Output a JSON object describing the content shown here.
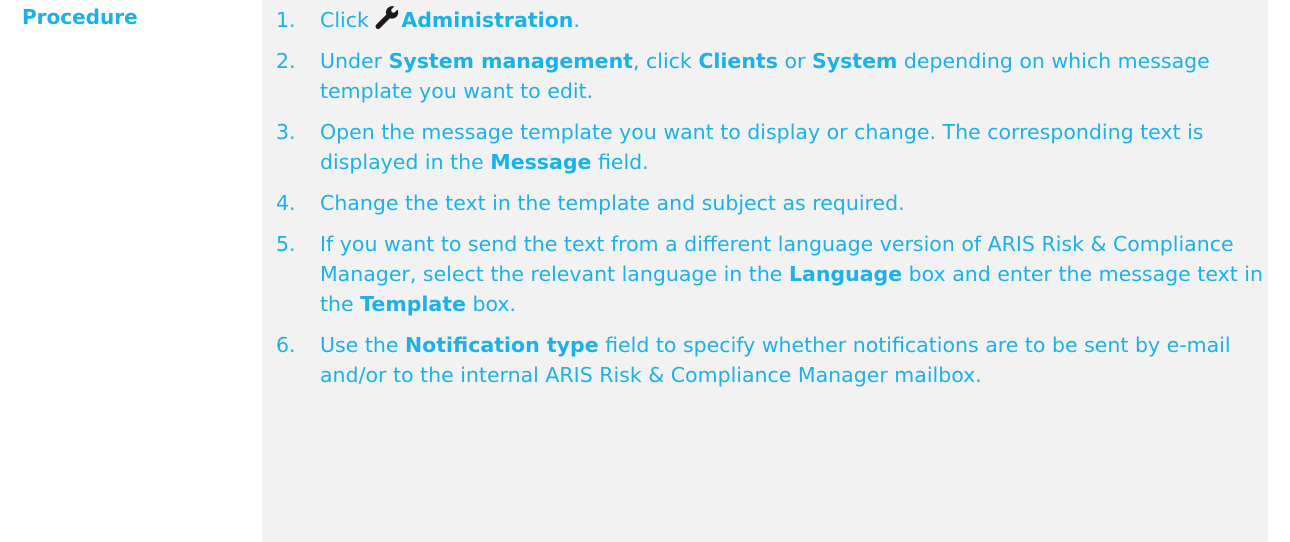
{
  "procedure": {
    "label": "Procedure",
    "steps": [
      {
        "number": "1.",
        "parts": [
          {
            "text": "Click ",
            "bold": false
          },
          {
            "icon": "wrench-icon"
          },
          {
            "text": "Administration",
            "bold": true
          },
          {
            "text": ".",
            "bold": false
          }
        ]
      },
      {
        "number": "2.",
        "parts": [
          {
            "text": "Under ",
            "bold": false
          },
          {
            "text": "System management",
            "bold": true
          },
          {
            "text": ", click ",
            "bold": false
          },
          {
            "text": "Clients",
            "bold": true
          },
          {
            "text": " or ",
            "bold": false
          },
          {
            "text": "System",
            "bold": true
          },
          {
            "text": " depending on which message template you want to edit.",
            "bold": false
          }
        ]
      },
      {
        "number": "3.",
        "parts": [
          {
            "text": "Open the message template you want to display or change. The corresponding text is displayed in the ",
            "bold": false
          },
          {
            "text": "Message",
            "bold": true
          },
          {
            "text": " field.",
            "bold": false
          }
        ]
      },
      {
        "number": "4.",
        "parts": [
          {
            "text": "Change the text in the template and subject as required.",
            "bold": false
          }
        ]
      },
      {
        "number": "5.",
        "parts": [
          {
            "text": "If you want to send the text from a different language version of ARIS Risk & Compliance Manager, select the relevant language in the ",
            "bold": false
          },
          {
            "text": "Language",
            "bold": true
          },
          {
            "text": " box and enter the message text in the ",
            "bold": false
          },
          {
            "text": "Template",
            "bold": true
          },
          {
            "text": " box.",
            "bold": false
          }
        ]
      },
      {
        "number": "6.",
        "parts": [
          {
            "text": "Use the ",
            "bold": false
          },
          {
            "text": "Notification type",
            "bold": true
          },
          {
            "text": " field to specify whether notifications are to be sent by e-mail and/or to the internal ARIS Risk & Compliance Manager mailbox.",
            "bold": false
          }
        ]
      }
    ]
  },
  "colors": {
    "text": "#1cb1e8",
    "content_background": "#f2f2f2",
    "icon": "#1a1a1a"
  }
}
